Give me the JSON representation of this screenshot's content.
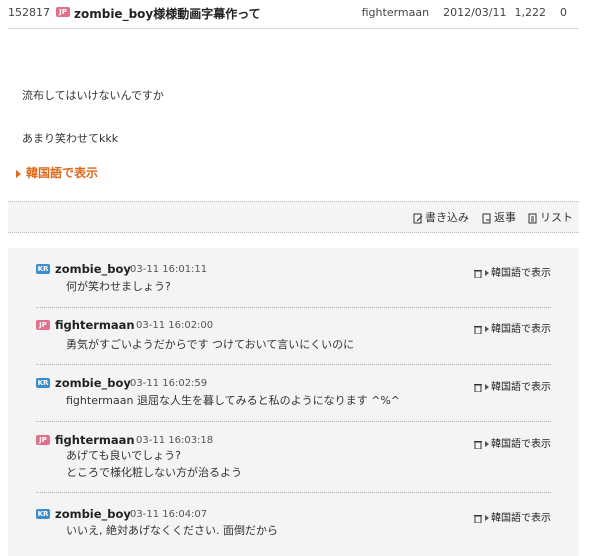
{
  "post": {
    "id": "152817",
    "flag": "JP",
    "title": "zombie_boy様様動画字幕作って",
    "author": "fightermaan",
    "date": "2012/03/11",
    "views": "1,222",
    "recommend": "0",
    "body_line1": "流布してはいけないんですか",
    "body_line2": "あまり笑わせてkkk",
    "translate_label": "韓国語で表示"
  },
  "toolbar": {
    "write_label": "書き込み",
    "reply_label": "返事",
    "list_label": "リスト"
  },
  "comments": [
    {
      "flag": "KR",
      "user": "zombie_boy",
      "time": "03-11 16:01:11",
      "lines": [
        "何が笑わせましょう?"
      ],
      "translate_label": "韓国語で表示"
    },
    {
      "flag": "JP",
      "user": "fightermaan",
      "time": "03-11 16:02:00",
      "lines": [
        "勇気がすごいようだからです つけておいて言いにくいのに"
      ],
      "translate_label": "韓国語で表示"
    },
    {
      "flag": "KR",
      "user": "zombie_boy",
      "time": "03-11 16:02:59",
      "lines": [
        "fightermaan 退屈な人生を暮してみると私のようになります ^%^"
      ],
      "translate_label": "韓国語で表示"
    },
    {
      "flag": "JP",
      "user": "fightermaan",
      "time": "03-11 16:03:18",
      "lines": [
        "あげても良いでしょう?",
        "ところで様化粧しない方が治るよう"
      ],
      "translate_label": "韓国語で表示"
    },
    {
      "flag": "KR",
      "user": "zombie_boy",
      "time": "03-11 16:04:07",
      "lines": [
        "いいえ, 絶対あげなくください. 面倒だから"
      ],
      "translate_label": "韓国語で表示"
    }
  ]
}
